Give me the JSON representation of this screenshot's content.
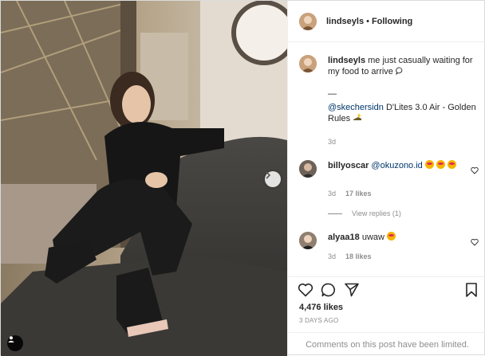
{
  "header": {
    "username": "lindseyls",
    "separator": "•",
    "follow_status": "Following"
  },
  "caption": {
    "username": "lindseyls",
    "text": "me just casually waiting for my food to arrive",
    "divider": "—",
    "mention": "@skechersidn",
    "product": "D'Lites 3.0 Air - Golden Rules",
    "time": "3d"
  },
  "comments": [
    {
      "username": "billyoscar",
      "mention": "@okuzono.id",
      "time": "3d",
      "likes": "17 likes",
      "view_replies": "View replies (1)"
    },
    {
      "username": "alyaa18",
      "text": "uwaw",
      "time": "3d",
      "likes": "18 likes"
    }
  ],
  "actions": {
    "likes": "4,476 likes",
    "timestamp": "3 DAYS AGO"
  },
  "footer": {
    "notice": "Comments on this post have been limited."
  },
  "icons": {
    "like": "heart-icon",
    "comment": "comment-icon",
    "share": "share-icon",
    "save": "bookmark-icon",
    "next": "chevron-right-icon",
    "tag": "user-tag-icon"
  },
  "colors": {
    "text": "#262626",
    "muted": "#8e8e8e",
    "link": "#00376b",
    "border": "#dbdbdb"
  }
}
